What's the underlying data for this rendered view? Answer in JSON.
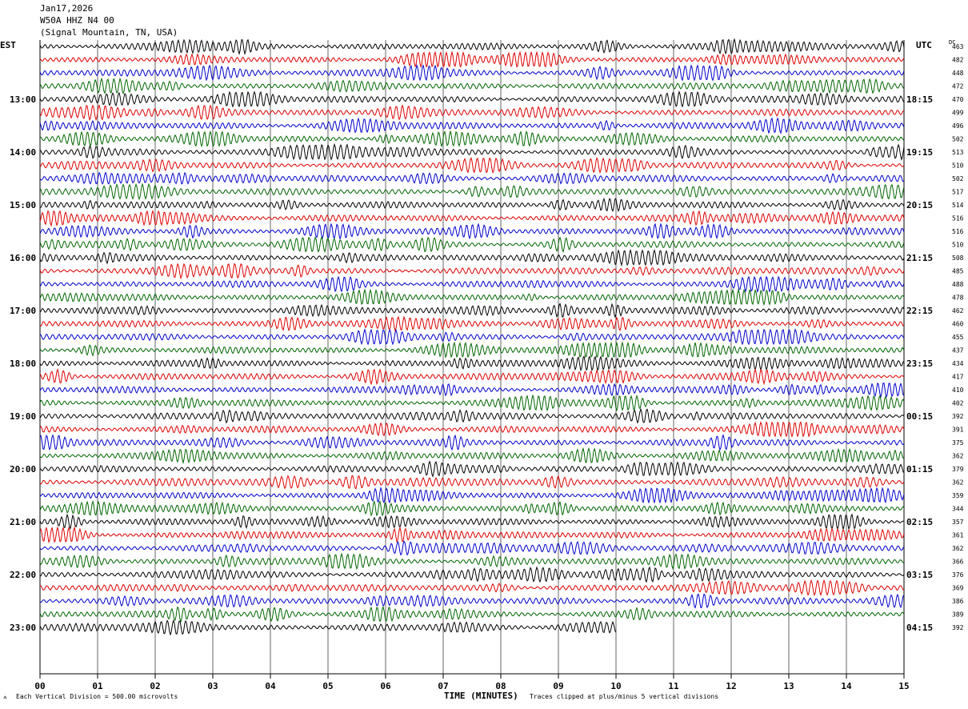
{
  "header": {
    "date": "Jan17,2026",
    "station": "W50A HHZ N4 00",
    "location": "(Signal Mountain, TN, USA)"
  },
  "labels": {
    "left_tz": "EST",
    "right_tz": "UTC",
    "dc_header": "DC",
    "x_title": "TIME (MINUTES)",
    "scale_note": "Each Vertical Division =  500.00 microvolts",
    "clip_note": "Traces clipped at plus/minus 5 vertical divisions"
  },
  "colors": {
    "trace_cycle": [
      "#000000",
      "#dd0000",
      "#0000cc",
      "#006600"
    ],
    "grid": "#000000"
  },
  "chart_data": {
    "type": "line",
    "x_range": [
      0,
      15
    ],
    "x_ticks": [
      "00",
      "01",
      "02",
      "03",
      "04",
      "05",
      "06",
      "07",
      "08",
      "09",
      "10",
      "11",
      "12",
      "13",
      "14",
      "15"
    ],
    "left_hour_labels": [
      "13:00",
      "14:00",
      "15:00",
      "16:00",
      "17:00",
      "18:00",
      "19:00",
      "20:00",
      "21:00",
      "22:00",
      "23:00"
    ],
    "right_hour_labels": [
      "18:15",
      "19:15",
      "20:15",
      "21:15",
      "22:15",
      "23:15",
      "00:15",
      "01:15",
      "02:15",
      "03:15",
      "04:15"
    ],
    "dc_offsets": [
      463,
      482,
      448,
      472,
      470,
      499,
      496,
      502,
      513,
      510,
      502,
      517,
      514,
      516,
      516,
      510,
      508,
      485,
      488,
      478,
      462,
      460,
      455,
      437,
      434,
      417,
      410,
      402,
      392,
      391,
      375,
      362,
      379,
      362,
      359,
      344,
      357,
      361,
      362,
      366,
      376,
      369,
      386,
      389,
      392
    ],
    "trace_count": 45,
    "last_trace_end_minute": 10,
    "grid": "vertical lines at each minute"
  }
}
